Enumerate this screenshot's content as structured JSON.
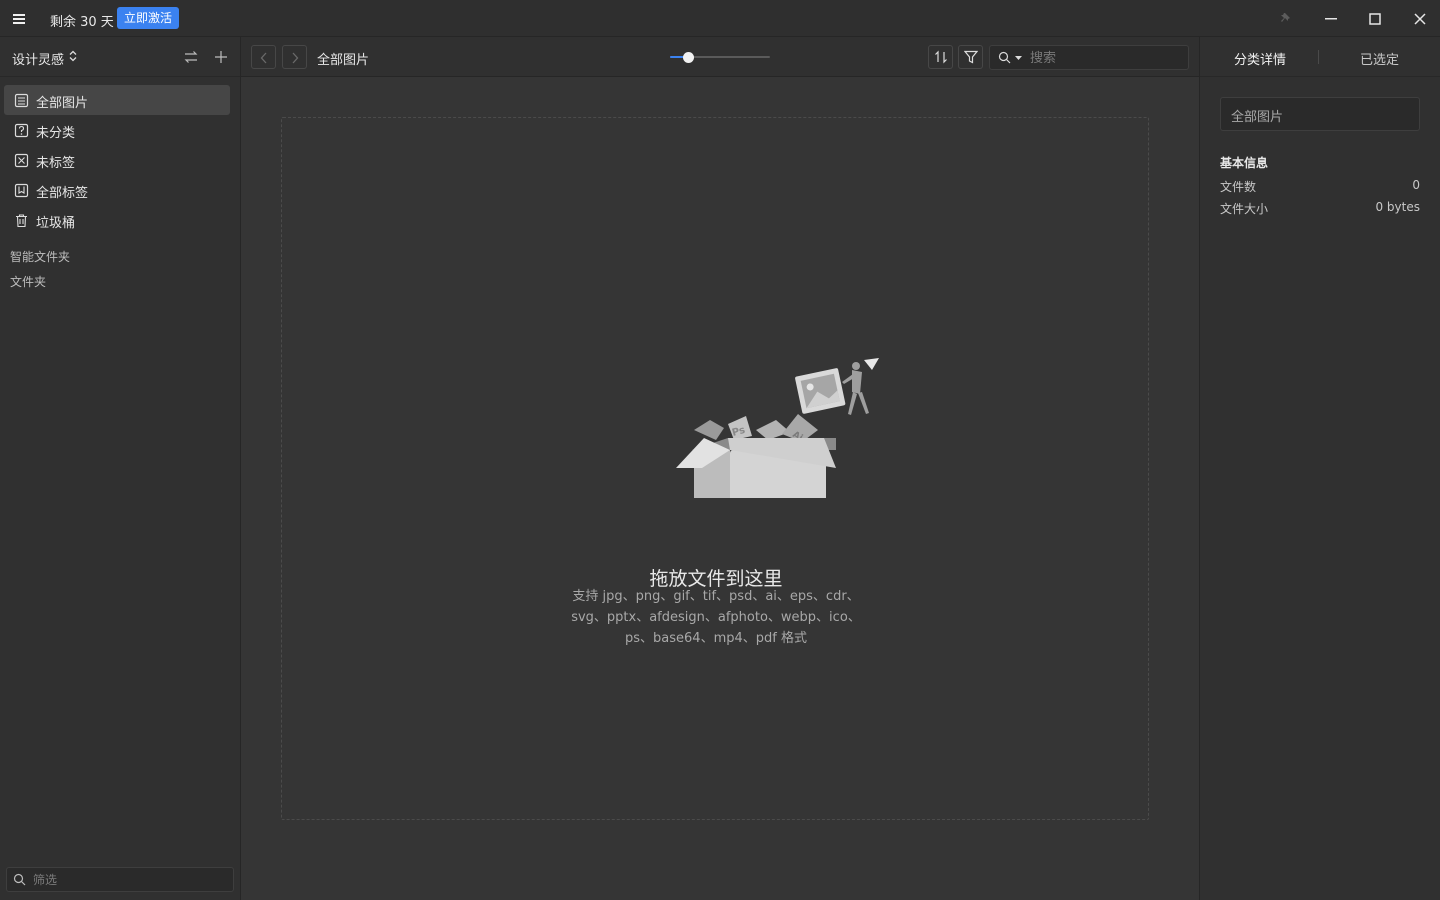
{
  "titlebar": {
    "trial_text": "剩余 30 天",
    "activate_label": "立即激活"
  },
  "sidebar": {
    "library_name": "设计灵感",
    "items": [
      {
        "label": "全部图片",
        "icon": "all-images-icon"
      },
      {
        "label": "未分类",
        "icon": "uncategorized-icon"
      },
      {
        "label": "未标签",
        "icon": "untagged-icon"
      },
      {
        "label": "全部标签",
        "icon": "all-tags-icon"
      },
      {
        "label": "垃圾桶",
        "icon": "trash-icon"
      }
    ],
    "smart_folders_label": "智能文件夹",
    "folders_label": "文件夹",
    "filter_placeholder": "筛选"
  },
  "toolbar": {
    "title": "全部图片",
    "thumbnail_size": 0.18,
    "search_placeholder": "搜索"
  },
  "main": {
    "drop_title": "拖放文件到这里",
    "drop_desc_lines": [
      "支持 jpg、png、gif、tif、psd、ai、eps、cdr、",
      "svg、pptx、afdesign、afphoto、webp、ico、",
      "ps、base64、mp4、pdf 格式"
    ]
  },
  "right_panel": {
    "tab_details": "分类详情",
    "tab_selected": "已选定",
    "name_value": "全部图片",
    "basic_info_heading": "基本信息",
    "file_count_label": "文件数",
    "file_count_value": "0",
    "file_size_label": "文件大小",
    "file_size_value": "0 bytes"
  },
  "colors": {
    "accent": "#3b82f0",
    "background": "#353535",
    "panel": "#303030"
  }
}
